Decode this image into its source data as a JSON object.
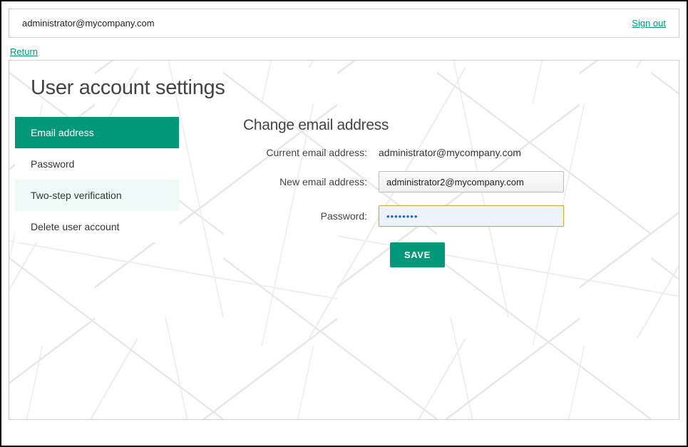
{
  "header": {
    "user_email": "administrator@mycompany.com",
    "signout_label": "Sign out"
  },
  "return_label": "Return",
  "page_title": "User account settings",
  "sidebar": {
    "items": [
      {
        "label": "Email address"
      },
      {
        "label": "Password"
      },
      {
        "label": "Two-step verification"
      },
      {
        "label": "Delete user account"
      }
    ]
  },
  "form": {
    "section_title": "Change email address",
    "current_email_label": "Current email address:",
    "current_email_value": "administrator@mycompany.com",
    "new_email_label": "New email address:",
    "new_email_value": "administrator2@mycompany.com",
    "password_label": "Password:",
    "password_value": "••••••••",
    "save_label": "SAVE"
  },
  "colors": {
    "accent": "#009879"
  }
}
